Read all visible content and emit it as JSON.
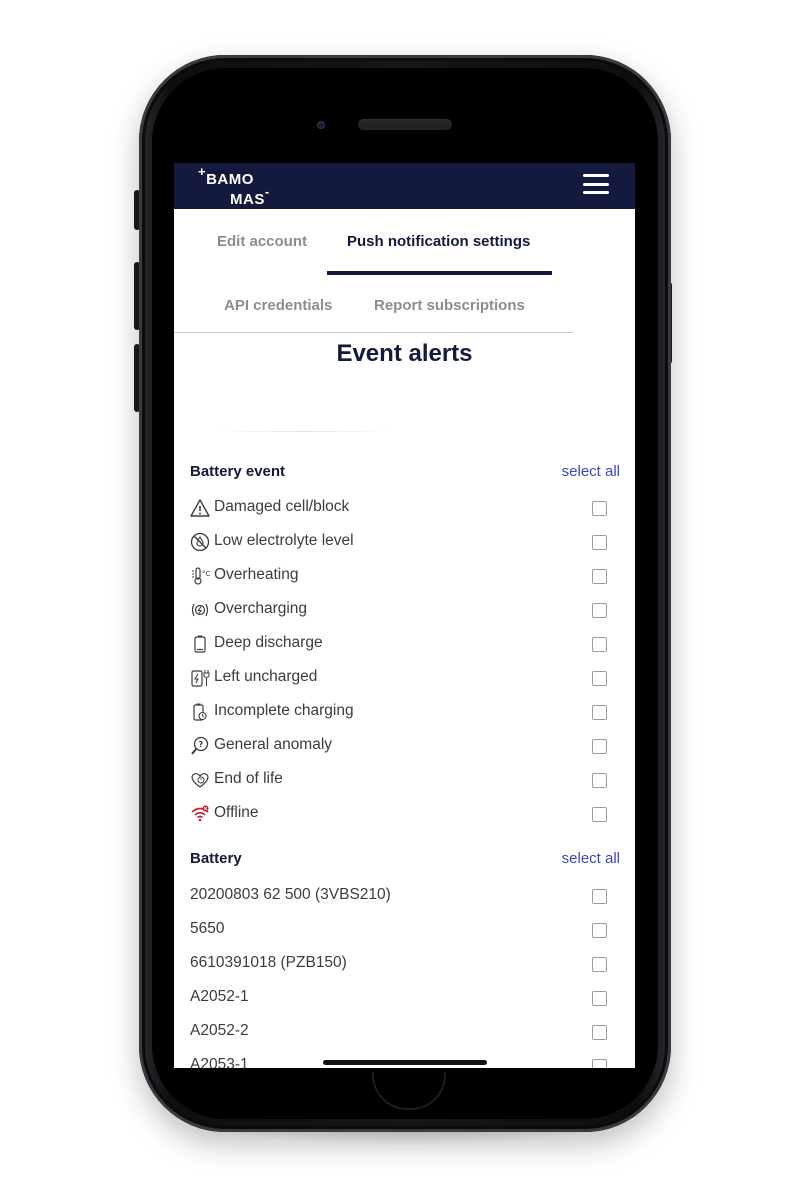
{
  "app": {
    "logo_line1": "BAMO",
    "logo_line2": "MAS",
    "logo_plus": "+",
    "logo_minus": "-"
  },
  "tabs": [
    {
      "label": "Edit account",
      "active": false
    },
    {
      "label": "Push notification settings",
      "active": true
    },
    {
      "label": "API credentials",
      "active": false
    },
    {
      "label": "Report subscriptions",
      "active": false
    }
  ],
  "page": {
    "title": "Event alerts"
  },
  "battery_event": {
    "title": "Battery event",
    "select_all": "select all",
    "items": [
      {
        "label": "Damaged cell/block",
        "icon": "warning-triangle-icon",
        "checked": false
      },
      {
        "label": "Low electrolyte level",
        "icon": "no-drop-icon",
        "checked": false
      },
      {
        "label": "Overheating",
        "icon": "thermometer-icon",
        "checked": false
      },
      {
        "label": "Overcharging",
        "icon": "charging-waves-icon",
        "checked": false
      },
      {
        "label": "Deep discharge",
        "icon": "battery-empty-icon",
        "checked": false
      },
      {
        "label": "Left uncharged",
        "icon": "battery-plug-icon",
        "checked": false
      },
      {
        "label": "Incomplete charging",
        "icon": "battery-clock-icon",
        "checked": false
      },
      {
        "label": "General anomaly",
        "icon": "magnifier-question-icon",
        "checked": false
      },
      {
        "label": "End of life",
        "icon": "heart-battery-icon",
        "checked": false
      },
      {
        "label": "Offline",
        "icon": "wifi-off-icon",
        "checked": false
      }
    ]
  },
  "battery": {
    "title": "Battery",
    "select_all": "select all",
    "items": [
      {
        "label": "20200803 62 500 (3VBS210)",
        "checked": false
      },
      {
        "label": "5650",
        "checked": false
      },
      {
        "label": "6610391018 (PZB150)",
        "checked": false
      },
      {
        "label": "A2052-1",
        "checked": false
      },
      {
        "label": "A2052-2",
        "checked": false
      },
      {
        "label": "A2053-1",
        "checked": false
      }
    ]
  },
  "colors": {
    "header_bg": "#131a3d",
    "accent_link": "#3b4ab8",
    "offline_icon": "#c0243a"
  }
}
